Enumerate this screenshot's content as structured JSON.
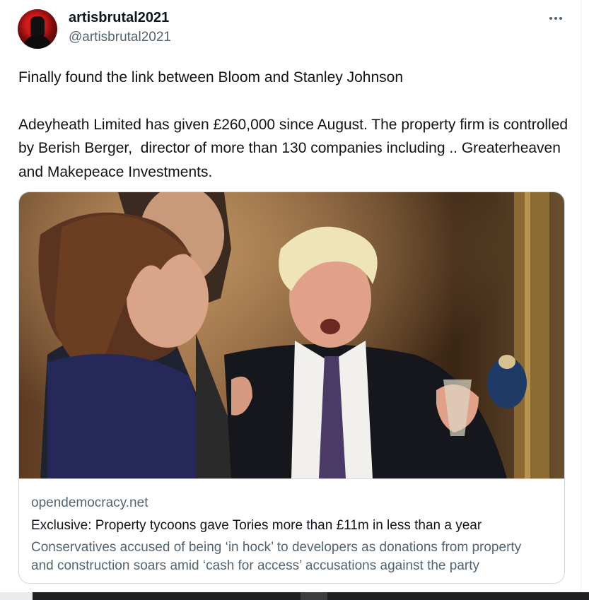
{
  "tweet": {
    "author": {
      "display_name": "artisbrutal2021",
      "handle": "@artisbrutal2021",
      "avatar_icon": "avatar-red-figure"
    },
    "more_icon": "more-horizontal-icon",
    "text_lines": [
      "Finally found the link between Bloom and Stanley Johnson",
      "Adeyheath Limited has given £260,000 since August. The property firm is controlled by Berish Berger,  director of more than 130 companies including .. Greaterheaven and Makepeace Investments."
    ]
  },
  "card": {
    "domain": "opendemocracy.net",
    "title": "Exclusive: Property tycoons gave Tories more than £11m in less than a year",
    "description": "Conservatives accused of being ‘in hock’ to developers as donations from property and construction soars amid ‘cash for access’ accusations against the party"
  },
  "colors": {
    "primary_text": "#0f1419",
    "secondary_text": "#536471",
    "border": "#cfd9de"
  }
}
